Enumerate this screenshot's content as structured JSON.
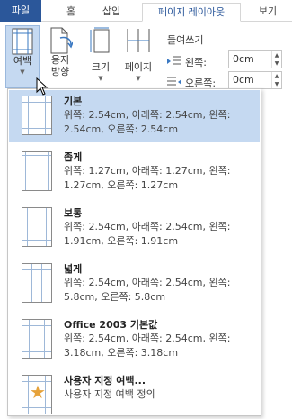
{
  "tabs": {
    "file": "파일",
    "home": "홈",
    "insert": "삽입",
    "layout": "페이지 레이아웃",
    "view": "보기"
  },
  "ribbon": {
    "margins": "여백",
    "orientation_line1": "용지",
    "orientation_line2": "방향",
    "size": "크기",
    "columns": "페이지"
  },
  "indent": {
    "title": "들여쓰기",
    "left_label": "왼쪽:",
    "left_value": "0cm",
    "right_label": "오른쪽:",
    "right_value": "0cm"
  },
  "margin_options": [
    {
      "title": "기본",
      "desc": "위쪽: 2.54cm, 아래쪽: 2.54cm, 왼쪽: 2.54cm, 오른쪽: 2.54cm",
      "selected": true
    },
    {
      "title": "좁게",
      "desc": "위쪽: 1.27cm, 아래쪽: 1.27cm, 왼쪽: 1.27cm, 오른쪽: 1.27cm",
      "selected": false
    },
    {
      "title": "보통",
      "desc": "위쪽: 2.54cm, 아래쪽: 2.54cm, 왼쪽: 1.91cm, 오른쪽: 1.91cm",
      "selected": false
    },
    {
      "title": "넓게",
      "desc": "위쪽: 2.54cm, 아래쪽: 2.54cm, 왼쪽: 5.8cm, 오른쪽: 5.8cm",
      "selected": false
    },
    {
      "title": "Office 2003 기본값",
      "desc": "위쪽: 2.54cm, 아래쪽: 2.54cm, 왼쪽: 3.18cm, 오른쪽: 3.18cm",
      "selected": false
    }
  ],
  "custom": {
    "title": "사용자 지정 여백...",
    "desc": "사용자 지정 여백 정의"
  },
  "colors": {
    "file_tab": "#2b579a",
    "selected": "#c5d9f1",
    "star": "#e6a23a"
  }
}
